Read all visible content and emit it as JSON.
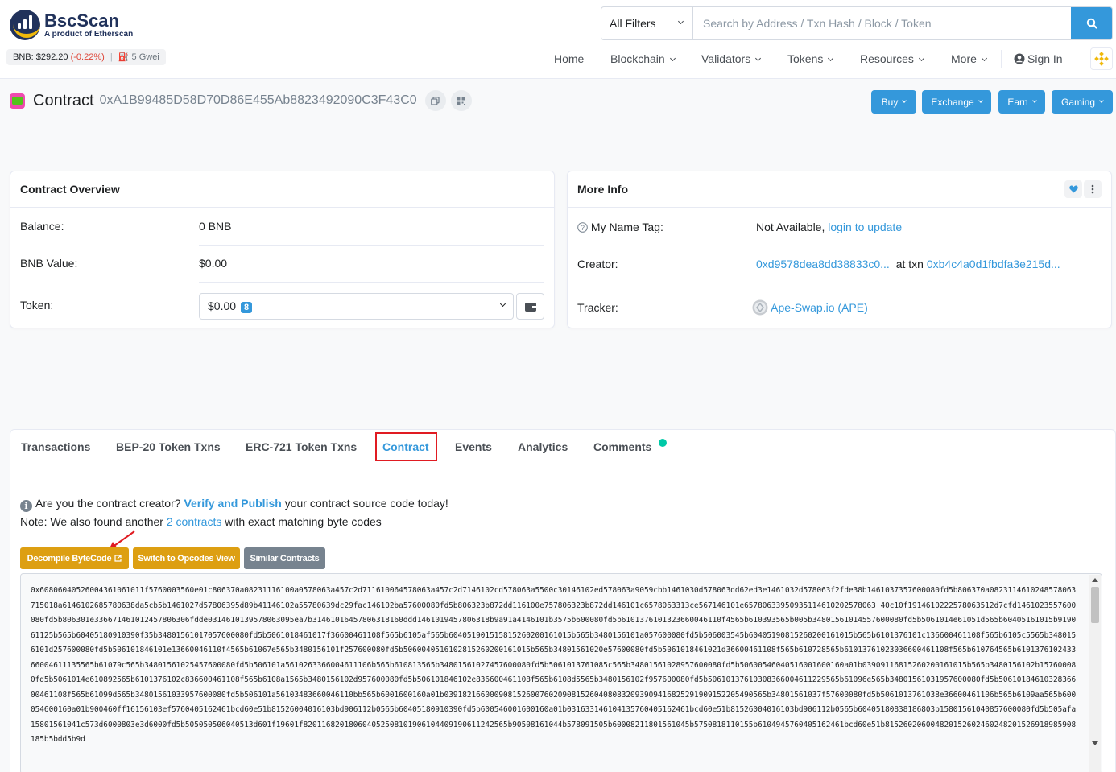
{
  "header": {
    "brand": "BscScan",
    "brand_sub": "A product of Etherscan",
    "price_label": "BNB:",
    "price_value": "$292.20",
    "price_change": "(-0.22%)",
    "price_sep": "|",
    "gas": "5 Gwei",
    "filter_label": "All Filters",
    "search_placeholder": "Search by Address / Txn Hash / Block / Token",
    "nav": {
      "home": "Home",
      "blockchain": "Blockchain",
      "validators": "Validators",
      "tokens": "Tokens",
      "resources": "Resources",
      "more": "More",
      "signin": "Sign In"
    }
  },
  "page": {
    "title": "Contract",
    "address": "0xA1B99485D58D70D86E455Ab8823492090C3F43C0",
    "actions": {
      "buy": "Buy",
      "exchange": "Exchange",
      "earn": "Earn",
      "gaming": "Gaming"
    }
  },
  "overview": {
    "title": "Contract Overview",
    "balance_label": "Balance:",
    "balance_value": "0 BNB",
    "value_label": "BNB Value:",
    "value_value": "$0.00",
    "token_label": "Token:",
    "token_value": "$0.00",
    "token_count": "8"
  },
  "more_info": {
    "title": "More Info",
    "name_tag_label": "My Name Tag:",
    "name_tag_value": "Not Available,",
    "name_tag_link": "login to update",
    "creator_label": "Creator:",
    "creator_addr": "0xd9578dea8dd38833c0...",
    "creator_at": "at txn",
    "creator_txn": "0xb4c4a0d1fbdfa3e215d...",
    "tracker_label": "Tracker:",
    "tracker_value": "Ape-Swap.io (APE)"
  },
  "tabs": {
    "transactions": "Transactions",
    "bep20": "BEP-20 Token Txns",
    "erc721": "ERC-721 Token Txns",
    "contract": "Contract",
    "events": "Events",
    "analytics": "Analytics",
    "comments": "Comments"
  },
  "contract": {
    "note1_pre": "Are you the contract creator?",
    "note1_link": "Verify and Publish",
    "note1_post": "your contract source code today!",
    "note2_pre": "Note: We also found another",
    "note2_link": "2 contracts",
    "note2_post": "with exact matching byte codes",
    "btn_decompile": "Decompile ByteCode",
    "btn_opcodes": "Switch to Opcodes View",
    "btn_similar": "Similar Contracts",
    "bytecode": "0x608060405260043610610​11f5760003560e01c806370a08231116100a0578063a457c2d711610064578063a457c2d7146102cd578063a5500c30146102ed578063a9059cbb1461030d578063dd62ed3e1461032d578063f2fde38b146103735​7600080fd5b806370a082311461024857806371501​8a6146102685780638da5cb5b1461027d57806395d89b41146102a55780639dc29fac146102ba57600080fd5b806323b872dd116100e757806323b872dd146101c6578063313ce567146101e65780633950935114610202578063 40c10f19146102225780635​12d7cfd1461023557600080fd5b8063​01e33667146101245780630​6fdde0314610139578063095ea7b3146101645780631816​0ddd1461019457806318b9a91a4146101b357​5b600080fd5b61013761013236600461​10f4565b610393565b005b348015610145​57600080fd5b5061014e61051​d565b60405161015b919061125b565b60405180910390f35b348015610170​57600080fd5b5061018461017f366004611​08f565b61​05af565b604051901515815260200161015b565b348015610​1a057600080fd5b50600354​5b60405190815260200161015b565b610137​6101c136600461108f565b6105c5565b348015610​1d257600080fd5b5061018​46101e1366004611​0f4565b61067e565b348015​61​01f257600080fd5b50600405161​0​2815260200161​015b565b348015610​20e57600080fd5b506101​8461021d366004611​08f565b610728565b6101376102​30366004611​08f565b610764565b61013761​0243366004611135​565b61079c565b34801561025457600080fd5b50610​1a5610263366004611106​b565b610813565b348015​61027457600080fd5b5061013​761085c565b3480156102​89​57600080fd5b506005​46040516​0​01600160a01b03909116815260200161​015b565b3480156102b1​57600080fd5b5061014e6108​92565b610137​6102c836600461108f565b6108a1565b348015610​2d957600080fd5b5061018​46102e836600461108f565b61​08d5565b348015610​2f957600080fd5b50610137​6103083660​04611229565b61096e565b348015610319576000​80fd5b5061018461​03283660046110​8f565b61099d565b34801561033​9576000​80fd5b5061​01a561034836​6004611​0bb565b6001600160a01b03918216600090815260​0​76020908152​6040808320939094168252919091522054​90565b348015610​37f57600080fd5b5061013761038e366004611​06b565b6109aa565b60​0054600160a01b9​00460ff1615610​3ef5760405162461bcd60e51b815260040161​03bd906112b0565b60405180910390fd5b6005​4​6001600160a01b03163314610​4135760405162461bcd60e51b815260040161​03bd906112b0565b604051​8​08​3818​6803b158015610​40857600080fd5b505afa158015610​41c573d6000803e3d6000fd5b5050505060405​13d601f19601f820116820180604052508101906104409190611242565b905​08161044​b578091505b6000821180156104​5b575081811​0155​b6104945760​40516246​1bcd60e51b81526020600482015260​2​4602482015269​189​85908185b5bdd5b9d"
  }
}
